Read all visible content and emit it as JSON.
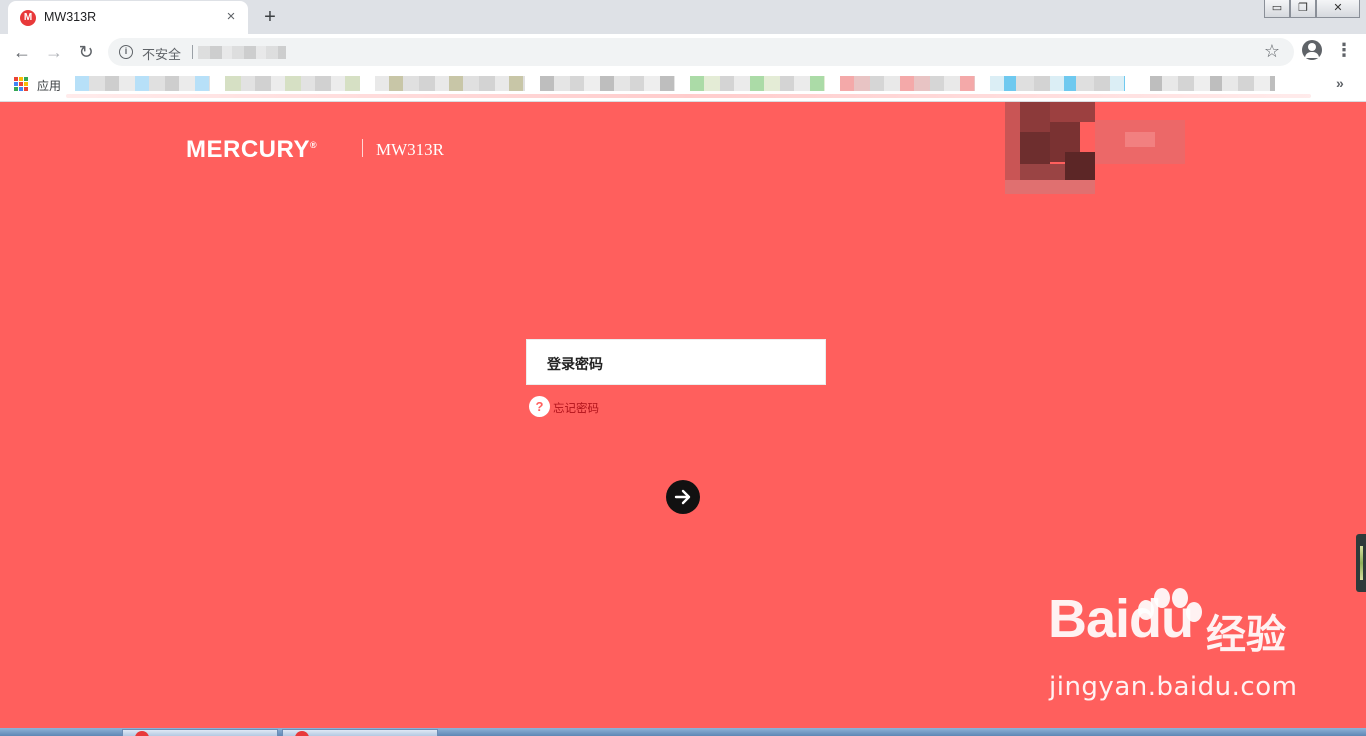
{
  "browser": {
    "tab": {
      "title": "MW313R",
      "favicon_letter": "M",
      "close_glyph": "×"
    },
    "new_tab_glyph": "+",
    "window_buttons": {
      "minimize": "▭",
      "restore": "❐",
      "close": "✕"
    },
    "nav": {
      "back": "←",
      "forward": "→",
      "reload": "↻"
    },
    "omnibox": {
      "security_label": "不安全",
      "info_glyph": "i"
    },
    "bookmark_star": "☆",
    "menu_glyph": "⋮",
    "bookmarks_bar": {
      "apps_label": "应用",
      "more_glyph": "»"
    }
  },
  "router_page": {
    "brand": "MERCURY",
    "brand_mark": "®",
    "model": "MW313R",
    "password_placeholder": "登录密码",
    "forgot_password": "忘记密码",
    "help_glyph": "?"
  },
  "watermark": {
    "logo": "Baidu",
    "suffix": "经验",
    "url": "jingyan.baidu.com"
  },
  "colors": {
    "page_background": "#ff5f5d",
    "favicon": "#e8393a",
    "login_button": "#111111",
    "forgot_text": "#b0121a"
  }
}
